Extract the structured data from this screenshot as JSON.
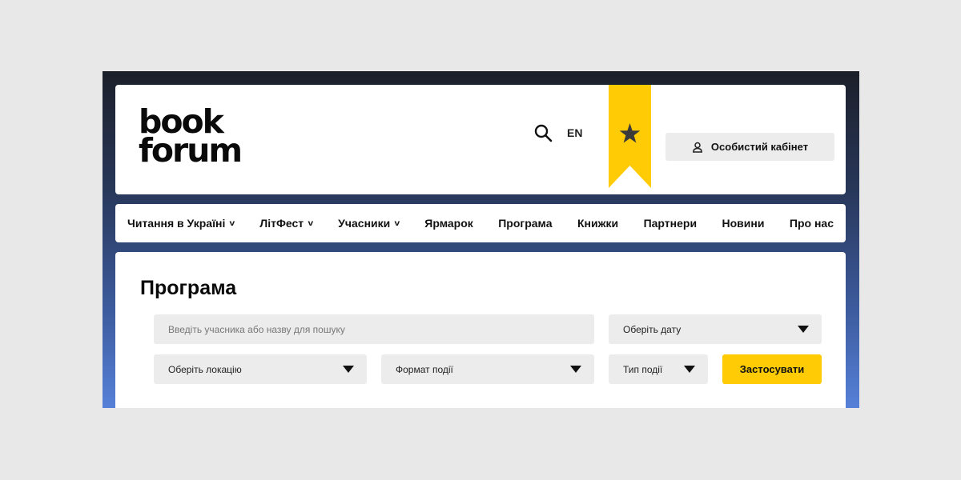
{
  "header": {
    "logo_line1": "book",
    "logo_line2": "forum",
    "lang": "EN",
    "cabinet_label": "Особистий кабінет"
  },
  "nav": {
    "items": [
      {
        "label": "Читання в Україні",
        "dropdown": true
      },
      {
        "label": "ЛітФест",
        "dropdown": true
      },
      {
        "label": "Учасники",
        "dropdown": true
      },
      {
        "label": "Ярмарок",
        "dropdown": false
      },
      {
        "label": "Програма",
        "dropdown": false
      },
      {
        "label": "Книжки",
        "dropdown": false
      },
      {
        "label": "Партнери",
        "dropdown": false
      },
      {
        "label": "Новини",
        "dropdown": false
      },
      {
        "label": "Про нас",
        "dropdown": false
      }
    ],
    "chevron": "v"
  },
  "main": {
    "title": "Програма",
    "search_placeholder": "Введіть учасника або назву для пошуку",
    "date_select": "Оберіть дату",
    "location_select": "Оберіть локацію",
    "format_select": "Формат події",
    "type_select": "Тип події",
    "apply_label": "Застосувати"
  },
  "colors": {
    "accent_yellow": "#ffcb05",
    "field_bg": "#ececec"
  },
  "icons": [
    "search-icon",
    "bookmark-ribbon-icon",
    "star-icon",
    "user-icon",
    "dropdown-triangle-icon"
  ]
}
